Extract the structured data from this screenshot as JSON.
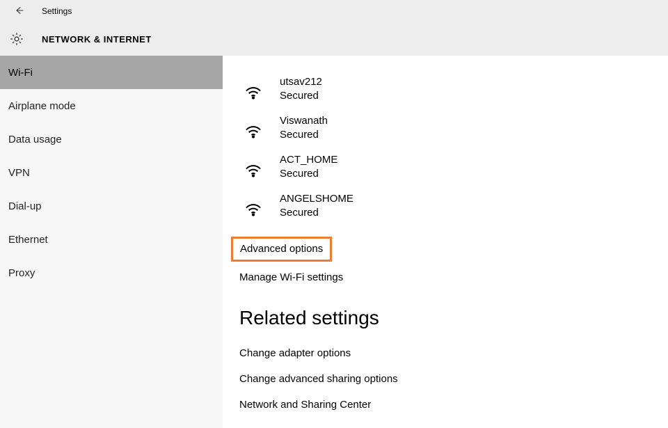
{
  "header": {
    "app_title": "Settings",
    "category_title": "NETWORK & INTERNET"
  },
  "sidebar": {
    "items": [
      {
        "label": "Wi-Fi",
        "selected": true
      },
      {
        "label": "Airplane mode",
        "selected": false
      },
      {
        "label": "Data usage",
        "selected": false
      },
      {
        "label": "VPN",
        "selected": false
      },
      {
        "label": "Dial-up",
        "selected": false
      },
      {
        "label": "Ethernet",
        "selected": false
      },
      {
        "label": "Proxy",
        "selected": false
      }
    ]
  },
  "networks": [
    {
      "name": "utsav212",
      "status": "Secured"
    },
    {
      "name": "Viswanath",
      "status": "Secured"
    },
    {
      "name": "ACT_HOME",
      "status": "Secured"
    },
    {
      "name": "ANGELSHOME",
      "status": "Secured"
    }
  ],
  "links": {
    "advanced_options": "Advanced options",
    "manage_wifi": "Manage Wi-Fi settings"
  },
  "related": {
    "heading": "Related settings",
    "items": [
      "Change adapter options",
      "Change advanced sharing options",
      "Network and Sharing Center"
    ]
  }
}
